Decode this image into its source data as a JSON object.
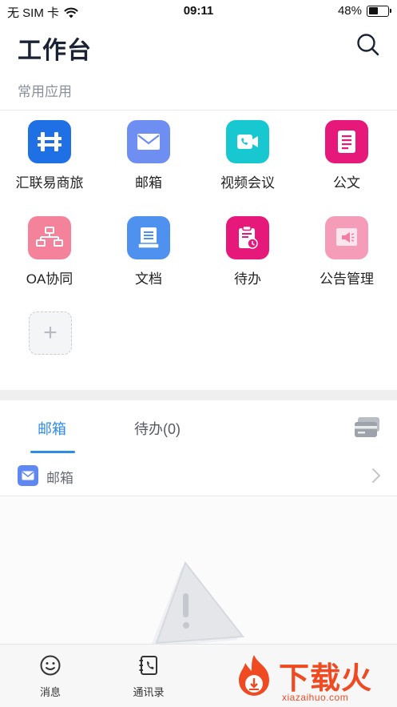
{
  "status": {
    "carrier": "无 SIM 卡",
    "time": "09:11",
    "battery_percent": "48%",
    "battery_level": 0.48
  },
  "header": {
    "title": "工作台"
  },
  "apps_section": {
    "label": "常用应用",
    "apps": [
      {
        "label": "汇联易商旅",
        "icon": "travel-icon",
        "color": "#1f6fe5"
      },
      {
        "label": "邮箱",
        "icon": "mail-icon",
        "color": "#6f8ef2"
      },
      {
        "label": "视频会议",
        "icon": "video-call-icon",
        "color": "#17c8d0"
      },
      {
        "label": "公文",
        "icon": "document-icon",
        "color": "#e6197a"
      },
      {
        "label": "OA协同",
        "icon": "org-chart-icon",
        "color": "#f4829b"
      },
      {
        "label": "文档",
        "icon": "file-icon",
        "color": "#4f91ef"
      },
      {
        "label": "待办",
        "icon": "todo-clipboard-icon",
        "color": "#e6197a"
      },
      {
        "label": "公告管理",
        "icon": "announcement-icon",
        "color": "#f59cb8"
      }
    ],
    "add_label": "+"
  },
  "tabs": {
    "items": [
      {
        "label": "邮箱",
        "active": true
      },
      {
        "label": "待办(0)",
        "active": false
      }
    ],
    "accent": "#2e8be6"
  },
  "mail_row": {
    "label": "邮箱"
  },
  "bottom_nav": {
    "items": [
      {
        "label": "消息",
        "icon": "smile-icon"
      },
      {
        "label": "通讯录",
        "icon": "contacts-icon"
      }
    ]
  },
  "watermark": {
    "text": "下载火",
    "sub": "xiazaihuo.com"
  }
}
